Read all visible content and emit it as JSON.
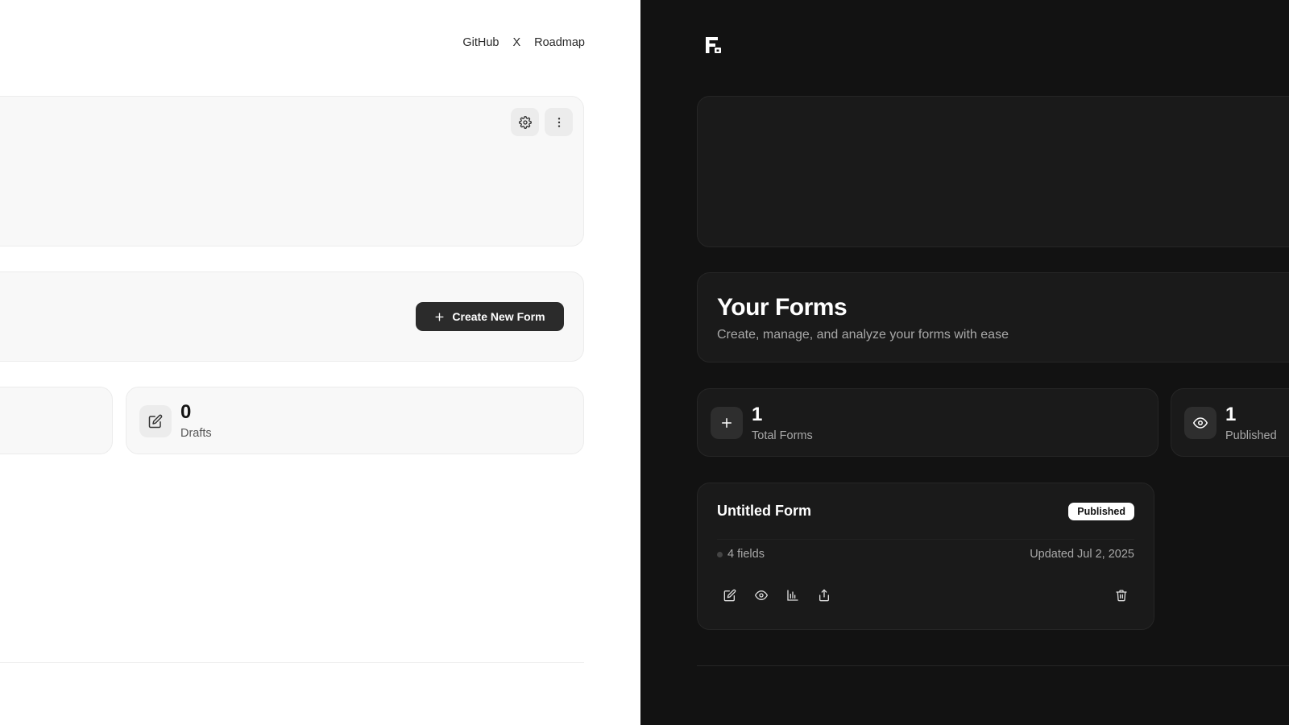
{
  "light": {
    "nav": [
      "GitHub",
      "X",
      "Roadmap"
    ],
    "create_button": "Create New Form",
    "drafts": {
      "count": "0",
      "label": "Drafts"
    }
  },
  "dark": {
    "title": "Your Forms",
    "subtitle": "Create, manage, and analyze your forms with ease",
    "stats": {
      "total": {
        "count": "1",
        "label": "Total Forms"
      },
      "published": {
        "count": "1",
        "label": "Published"
      }
    },
    "form": {
      "title": "Untitled Form",
      "status": "Published",
      "fields": "4 fields",
      "updated": "Updated Jul 2, 2025"
    }
  },
  "colors": {
    "dark_bg": "#121212",
    "dark_card": "#1a1a1a",
    "light_card": "#f8f8f8",
    "button_dark": "#2b2b2b"
  },
  "icons": [
    "settings-icon",
    "more-vertical-icon",
    "plus-icon",
    "edit-icon",
    "eye-icon",
    "bar-chart-icon",
    "share-icon",
    "trash-icon",
    "logo-icon"
  ]
}
